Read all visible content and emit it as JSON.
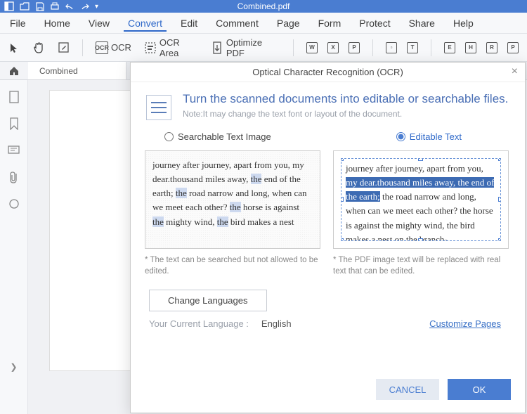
{
  "app": {
    "title": "Combined.pdf"
  },
  "menu": {
    "file": "File",
    "home": "Home",
    "view": "View",
    "convert": "Convert",
    "edit": "Edit",
    "comment": "Comment",
    "page": "Page",
    "form": "Form",
    "protect": "Protect",
    "share": "Share",
    "help": "Help"
  },
  "toolbar": {
    "ocr": "OCR",
    "ocr_area": "OCR Area",
    "optimize": "Optimize PDF"
  },
  "tabs": {
    "doc1": "Combined"
  },
  "dialog": {
    "title": "Optical Character Recognition (OCR)",
    "headline": "Turn the scanned documents into editable or searchable files.",
    "note": "Note:It may change the text font or layout of the document.",
    "opt_searchable": "Searchable Text Image",
    "opt_editable": "Editable Text",
    "preview_left_note": "* The text can be searched but not allowed to be edited.",
    "preview_right_note": "* The PDF image text will be replaced with real text that can be edited.",
    "sample_plain_1": "journey after journey, apart from you, my dear.thousand miles away, ",
    "sample_plain_the": "the",
    "sample_plain_2": " end of the earth; ",
    "sample_plain_3": " road narrow and long, when can we meet each other? ",
    "sample_plain_4": " horse is against ",
    "sample_plain_5": " mighty wind, ",
    "sample_plain_6": " bird makes a nest",
    "sample_edit_1": "journey after journey, apart from you, ",
    "sample_edit_sel": "my dear.thousand miles away, the end of the earth;",
    "sample_edit_2": " the road narrow and long, when can we meet each other? the horse is against the mighty wind, the bird makes a nest on the branch-",
    "change_lang": "Change Languages",
    "lang_label": "Your Current Language :",
    "lang_value": "English",
    "customize": "Customize Pages",
    "cancel": "CANCEL",
    "ok": "OK"
  }
}
